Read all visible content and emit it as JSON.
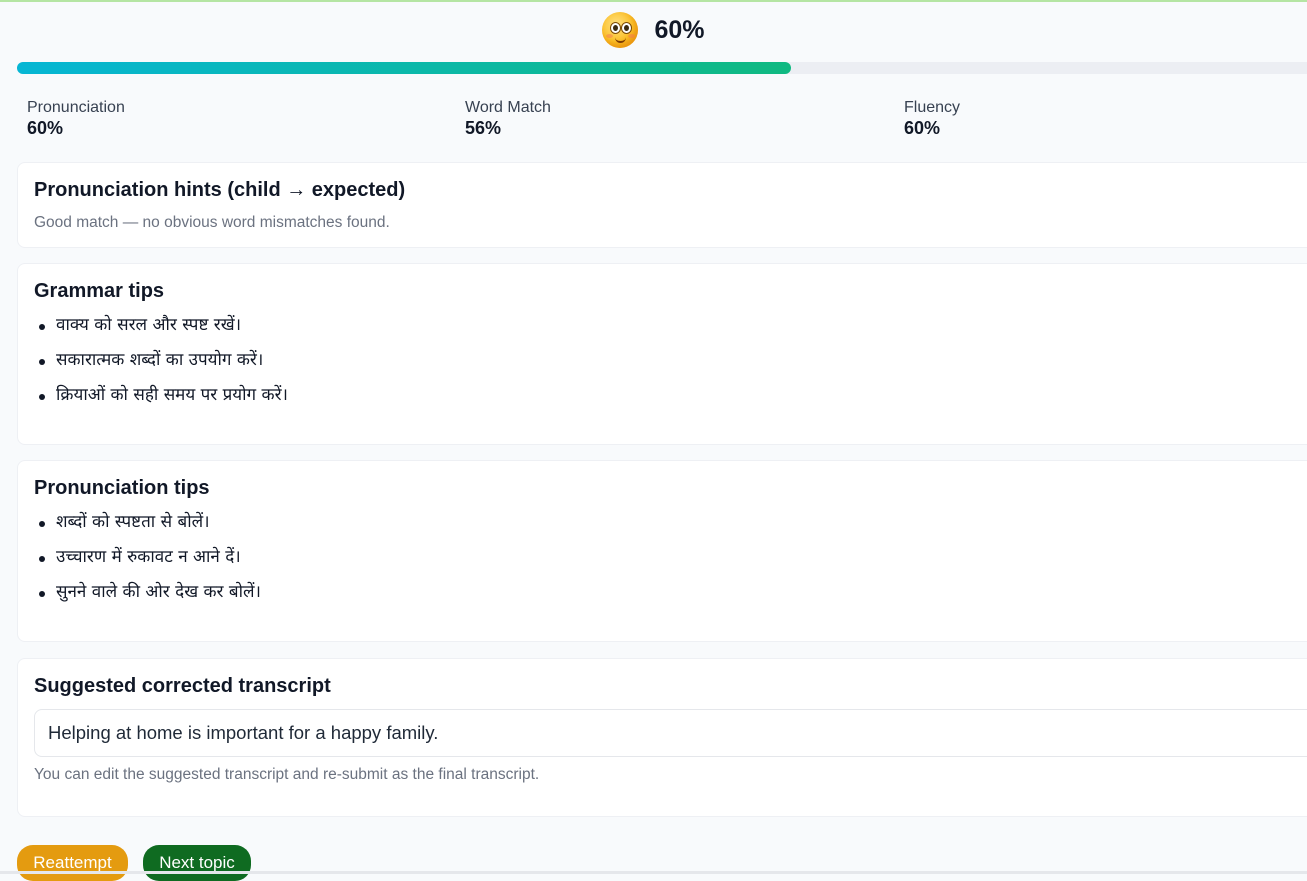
{
  "score": {
    "icon": "smiling-face-emoji-icon",
    "overall_label": "60%",
    "progress_fraction": 0.6,
    "gradient_colors": [
      "#06b6d4",
      "#10b981"
    ]
  },
  "metrics": [
    {
      "label": "Pronunciation",
      "value": "60%"
    },
    {
      "label": "Word Match",
      "value": "56%"
    },
    {
      "label": "Fluency",
      "value": "60%"
    }
  ],
  "hints": {
    "title": "Pronunciation hints (child → expected)",
    "message": "Good match — no obvious word mismatches found."
  },
  "grammar_tips": {
    "title": "Grammar tips",
    "items": [
      "वाक्य को सरल और स्पष्ट रखें।",
      "सकारात्मक शब्दों का उपयोग करें।",
      "क्रियाओं को सही समय पर प्रयोग करें।"
    ]
  },
  "pronunciation_tips": {
    "title": "Pronunciation tips",
    "items": [
      "शब्दों को स्पष्टता से बोलें।",
      "उच्चारण में रुकावट न आने दें।",
      "सुनने वाले की ओर देख कर बोलें।"
    ]
  },
  "transcript": {
    "title": "Suggested corrected transcript",
    "value": "Helping at home is important for a happy family.",
    "note": "You can edit the suggested transcript and re-submit as the final transcript."
  },
  "actions": {
    "reattempt_label": "Reattempt",
    "reattempt_color": "#e49b10",
    "next_label": "Next topic",
    "next_color": "#0f6b21"
  }
}
